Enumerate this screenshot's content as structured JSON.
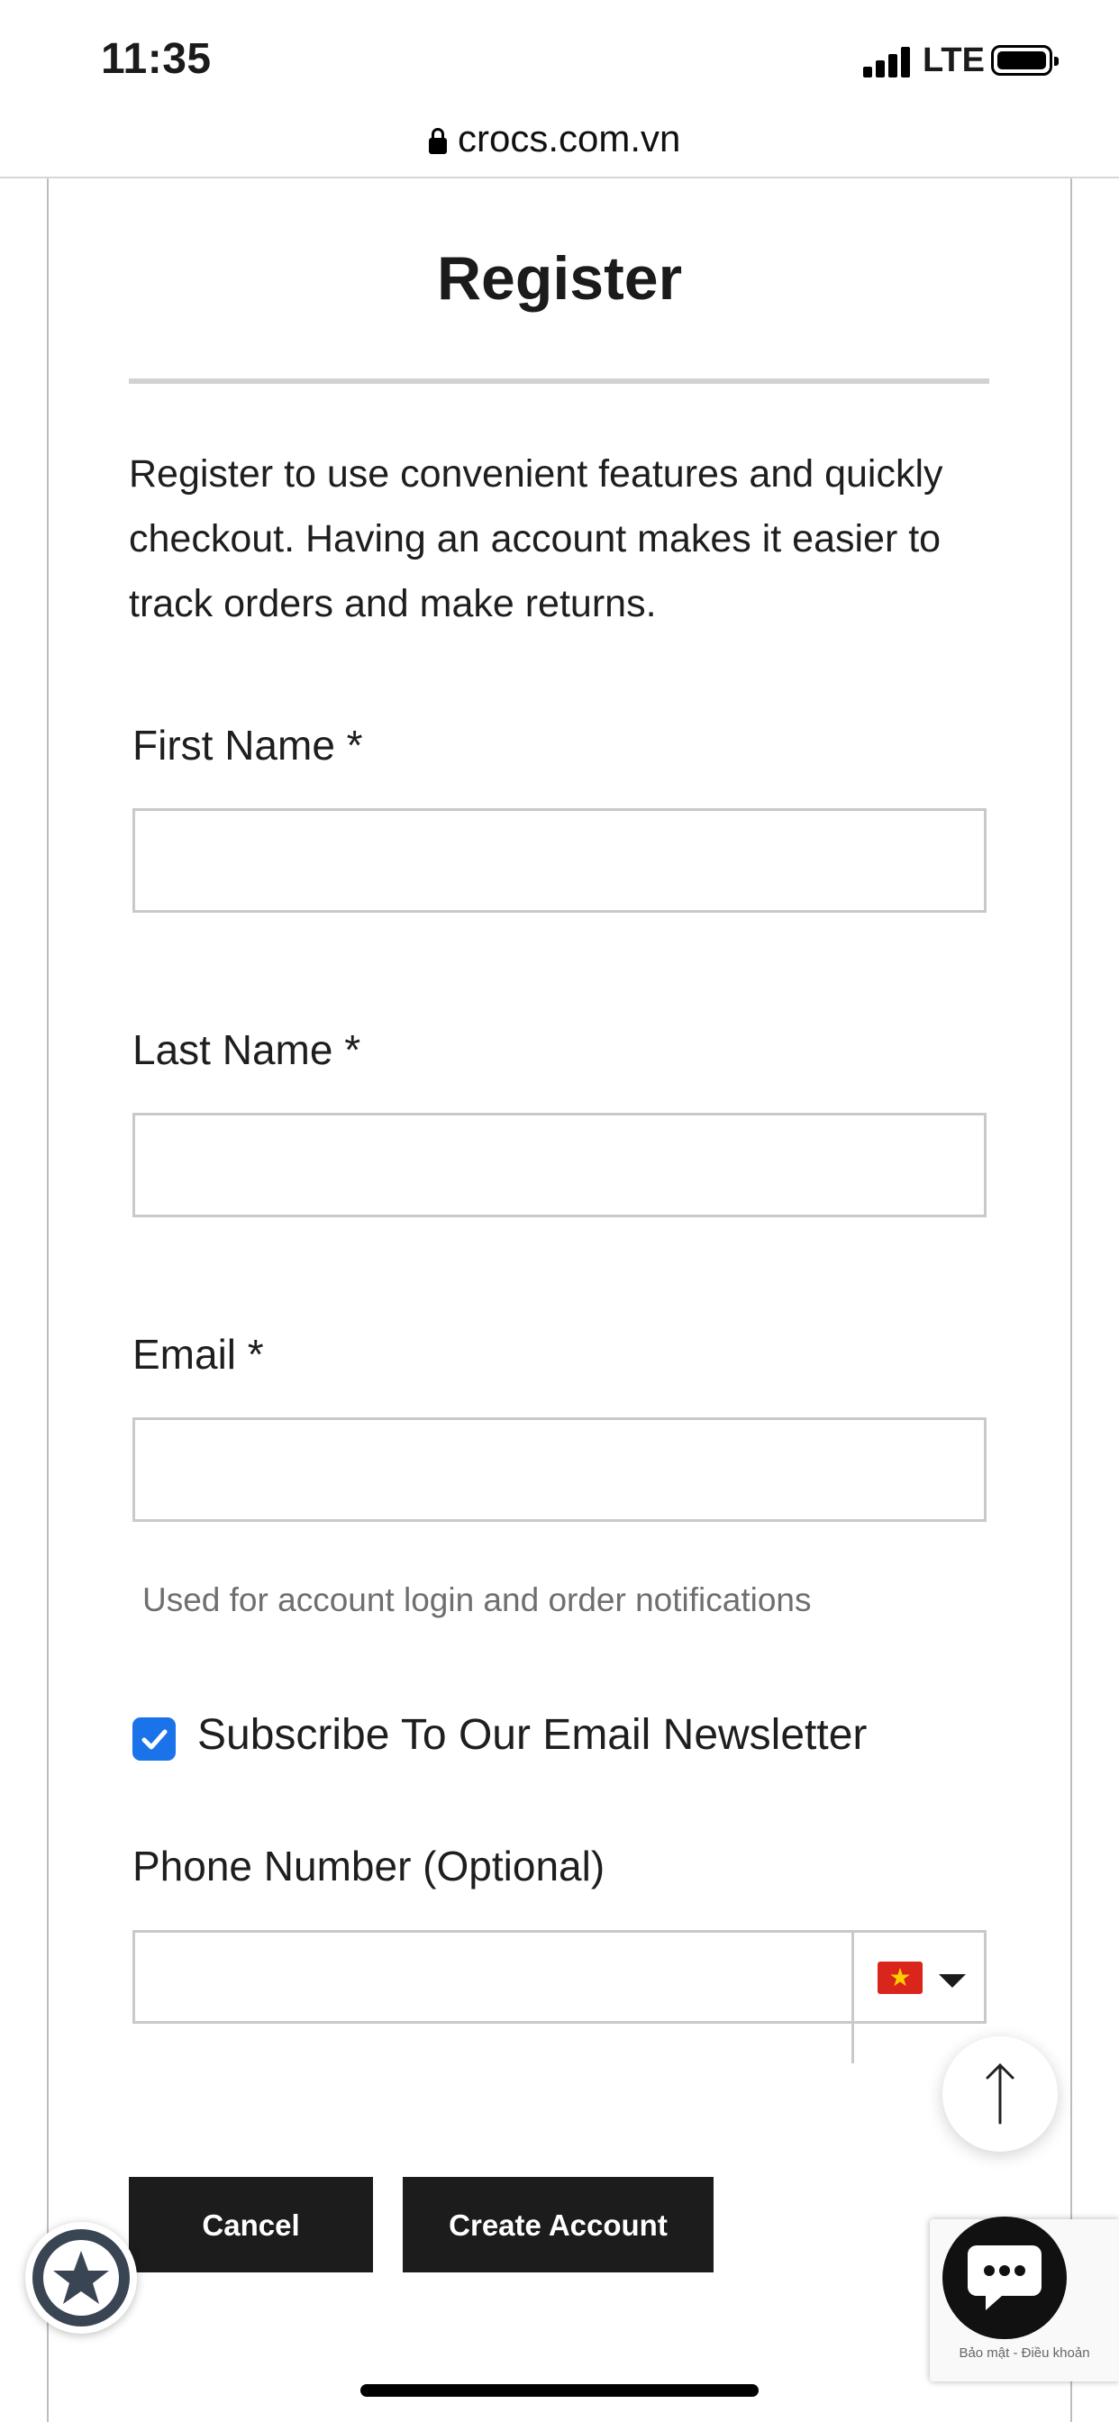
{
  "status_bar": {
    "time": "11:35",
    "network": "LTE"
  },
  "browser": {
    "url": "crocs.com.vn"
  },
  "form": {
    "title": "Register",
    "intro": "Register to use convenient features and quickly checkout. Having an account makes it easier to track orders and make returns.",
    "first_name": {
      "label": "First Name *",
      "value": ""
    },
    "last_name": {
      "label": "Last Name *",
      "value": ""
    },
    "email": {
      "label": "Email *",
      "value": "",
      "hint": "Used for account login and order notifications"
    },
    "newsletter": {
      "label": "Subscribe To Our Email Newsletter",
      "checked": true
    },
    "phone": {
      "label": "Phone Number (Optional)",
      "value": "",
      "country_flag": "vietnam-flag"
    },
    "buttons": {
      "cancel": "Cancel",
      "create": "Create Account"
    }
  },
  "recaptcha": {
    "text": "Bảo mật - Điều khoản"
  },
  "colors": {
    "accent": "#1a73e8",
    "button": "#1c1c1c",
    "border": "#c9c9c9"
  }
}
